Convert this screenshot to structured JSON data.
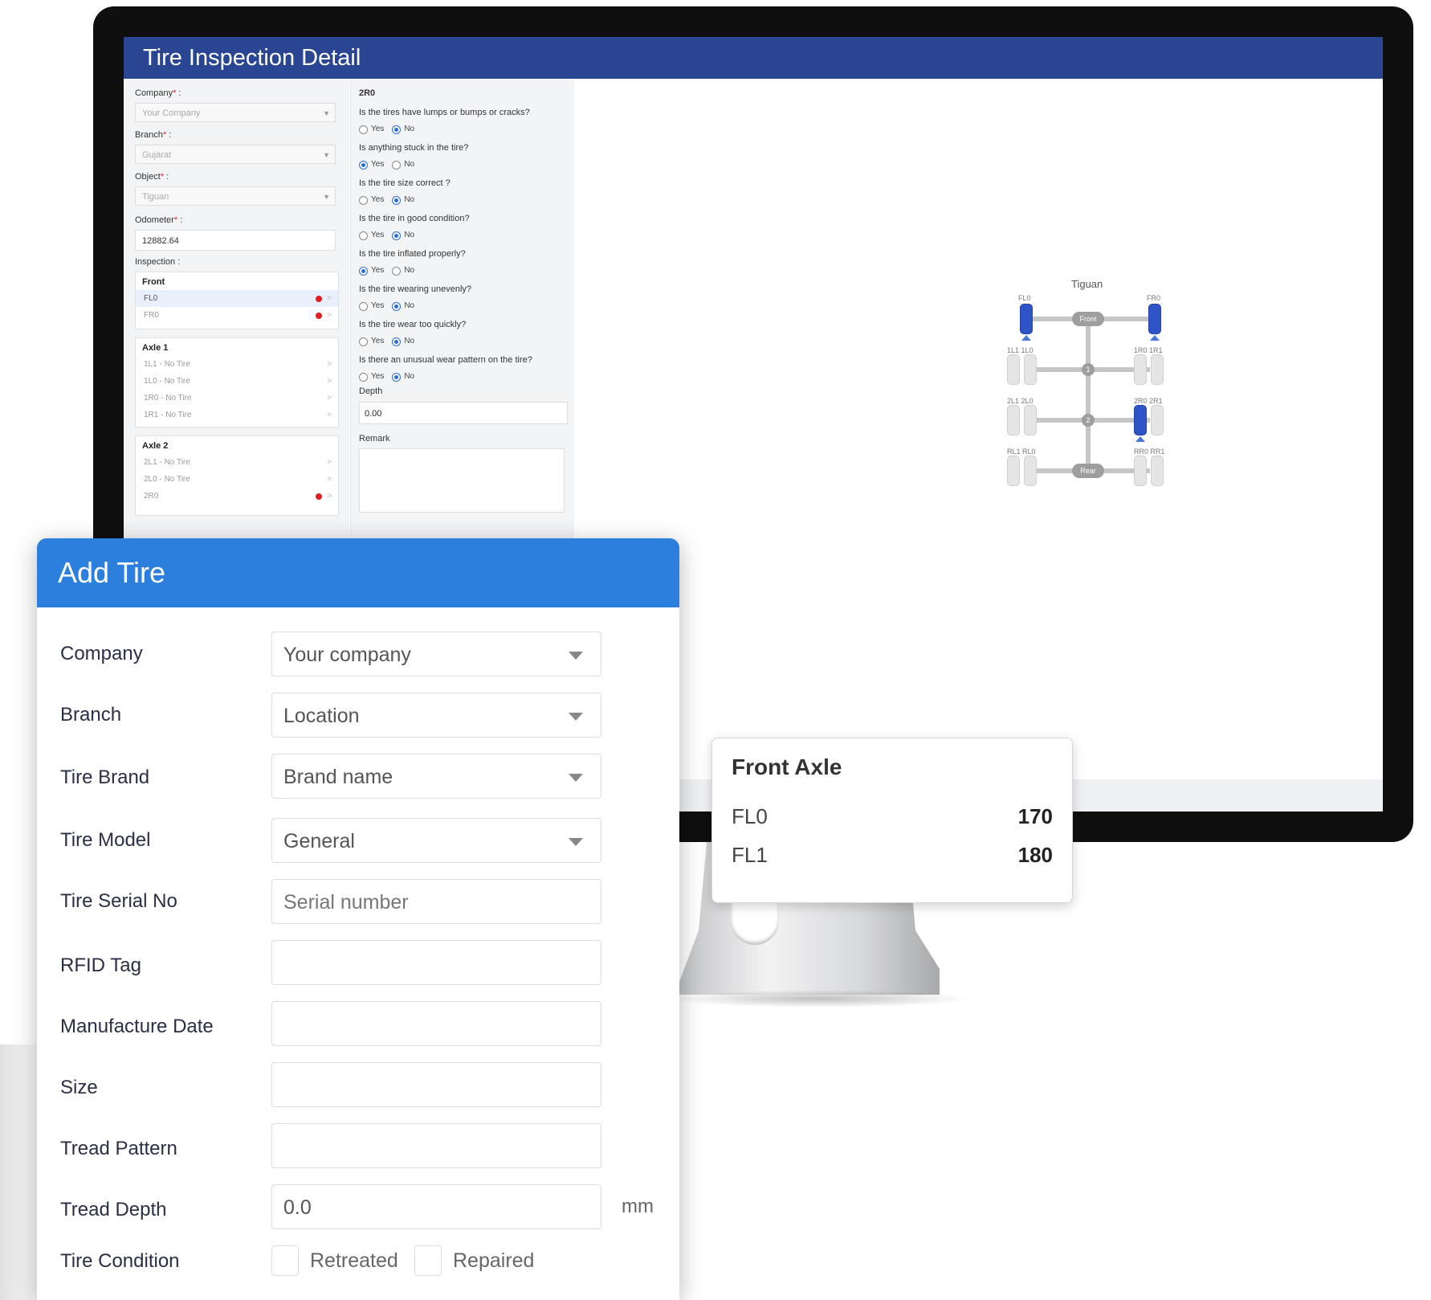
{
  "inspection": {
    "title": "Tire Inspection Detail",
    "left": {
      "company_label": "Company",
      "company_value": "Your Company",
      "branch_label": "Branch",
      "branch_value": "Gujarat",
      "object_label": "Object",
      "object_value": "Tiguan",
      "odometer_label": "Odometer",
      "odometer_value": "12882.64",
      "inspection_label": "Inspection :",
      "groups": [
        {
          "title": "Front",
          "items": [
            {
              "label": "FL0",
              "flag": true,
              "active": true
            },
            {
              "label": "FR0",
              "flag": true,
              "active": false
            }
          ]
        },
        {
          "title": "Axle 1",
          "items": [
            {
              "label": "1L1 - No Tire",
              "flag": false,
              "active": false
            },
            {
              "label": "1L0 - No Tire",
              "flag": false,
              "active": false
            },
            {
              "label": "1R0 - No Tire",
              "flag": false,
              "active": false
            },
            {
              "label": "1R1 - No Tire",
              "flag": false,
              "active": false
            }
          ]
        },
        {
          "title": "Axle 2",
          "items": [
            {
              "label": "2L1 - No Tire",
              "flag": false,
              "active": false
            },
            {
              "label": "2L0 - No Tire",
              "flag": false,
              "active": false
            },
            {
              "label": "2R0",
              "flag": true,
              "active": false
            }
          ]
        }
      ]
    },
    "middle": {
      "position": "2R0",
      "yes_label": "Yes",
      "no_label": "No",
      "questions": [
        {
          "text": "Is the tires have lumps or bumps or cracks?",
          "answer": "No"
        },
        {
          "text": "Is anything stuck in the tire?",
          "answer": "Yes"
        },
        {
          "text": "Is the tire size correct ?",
          "answer": "No"
        },
        {
          "text": "Is the tire in good condition?",
          "answer": "No"
        },
        {
          "text": "Is the tire inflated properly?",
          "answer": "Yes"
        },
        {
          "text": "Is the tire wearing unevenly?",
          "answer": "No"
        },
        {
          "text": "Is the tire wear too quickly?",
          "answer": "No"
        },
        {
          "text": "Is there an unusual wear pattern on the tire?",
          "answer": "No"
        }
      ],
      "depth_label": "Depth",
      "depth_value": "0.00",
      "remark_label": "Remark"
    },
    "diagram": {
      "title": "Tiguan",
      "labels": {
        "fl0": "FL0",
        "fr0": "FR0",
        "axle1_left": "1L1 1L0",
        "axle1_right": "1R0 1R1",
        "axle2_left": "2L1 2L0",
        "axle2_right": "2R0 2R1",
        "rear_left": "RL1 RL0",
        "rear_right": "RR0 RR1"
      },
      "front_pill": "Front",
      "rear_pill": "Rear",
      "axle1_num": "1",
      "axle2_num": "2",
      "colors": {
        "selected_tire": "#2f54c8",
        "empty_tire": "#e5e5e5"
      }
    }
  },
  "front_axle_card": {
    "title": "Front Axle",
    "rows": [
      {
        "label": "FL0",
        "value": "170"
      },
      {
        "label": "FL1",
        "value": "180"
      }
    ]
  },
  "add_tire": {
    "title": "Add Tire",
    "fields": {
      "company": {
        "label": "Company",
        "value": "Your company"
      },
      "branch": {
        "label": "Branch",
        "value": "Location"
      },
      "tire_brand": {
        "label": "Tire Brand",
        "value": "Brand name"
      },
      "tire_model": {
        "label": "Tire Model",
        "value": "General"
      },
      "serial": {
        "label": "Tire Serial No",
        "placeholder": "Serial number"
      },
      "rfid": {
        "label": "RFID Tag",
        "value": ""
      },
      "manufacture_date": {
        "label": "Manufacture Date",
        "value": ""
      },
      "size": {
        "label": "Size",
        "value": ""
      },
      "tread_pattern": {
        "label": "Tread Pattern",
        "value": ""
      },
      "tread_depth": {
        "label": "Tread Depth",
        "value": "0.0",
        "unit": "mm"
      },
      "tire_condition": {
        "label": "Tire Condition",
        "retreated": "Retreated",
        "repaired": "Repaired"
      }
    },
    "colors": {
      "header": "#2c7fdc"
    }
  }
}
